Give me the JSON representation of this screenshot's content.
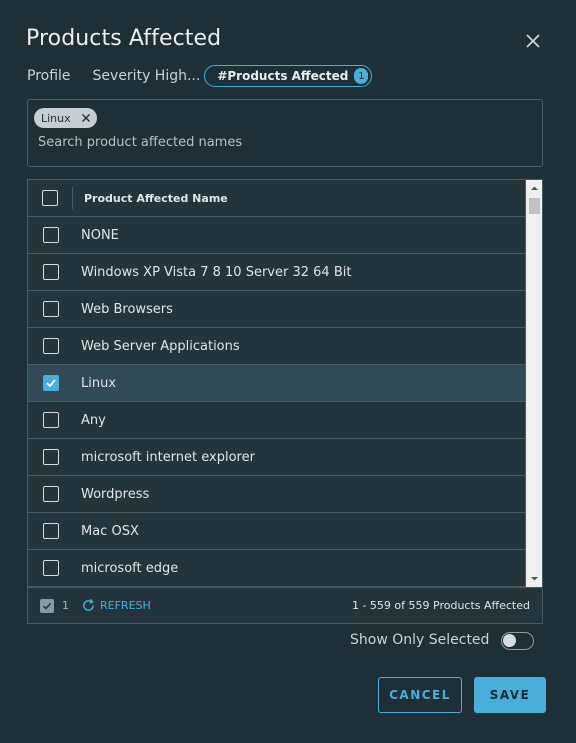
{
  "dialog": {
    "title": "Products Affected"
  },
  "breadcrumb": {
    "items": [
      "Profile",
      "Severity High..."
    ],
    "active_label": "#Products Affected",
    "active_badge": "1"
  },
  "search": {
    "chips": [
      "Linux"
    ],
    "placeholder": "Search product affected names"
  },
  "grid": {
    "column_header": "Product Affected Name",
    "rows": [
      {
        "name": "NONE",
        "checked": false
      },
      {
        "name": "Windows XP Vista 7 8 10 Server 32 64 Bit",
        "checked": false
      },
      {
        "name": "Web Browsers",
        "checked": false
      },
      {
        "name": "Web Server Applications",
        "checked": false
      },
      {
        "name": "Linux",
        "checked": true
      },
      {
        "name": "Any",
        "checked": false
      },
      {
        "name": "microsoft internet explorer",
        "checked": false
      },
      {
        "name": "Wordpress",
        "checked": false
      },
      {
        "name": "Mac OSX",
        "checked": false
      },
      {
        "name": "microsoft edge",
        "checked": false
      }
    ],
    "footer": {
      "selected_count": "1",
      "refresh_label": "REFRESH",
      "range_text": "1 - 559 of 559 Products Affected"
    }
  },
  "toggle": {
    "label": "Show Only Selected",
    "on": false
  },
  "actions": {
    "cancel_label": "CANCEL",
    "save_label": "SAVE"
  },
  "colors": {
    "accent": "#49afd9",
    "background": "#1f2f37",
    "selected_row": "#324956"
  }
}
